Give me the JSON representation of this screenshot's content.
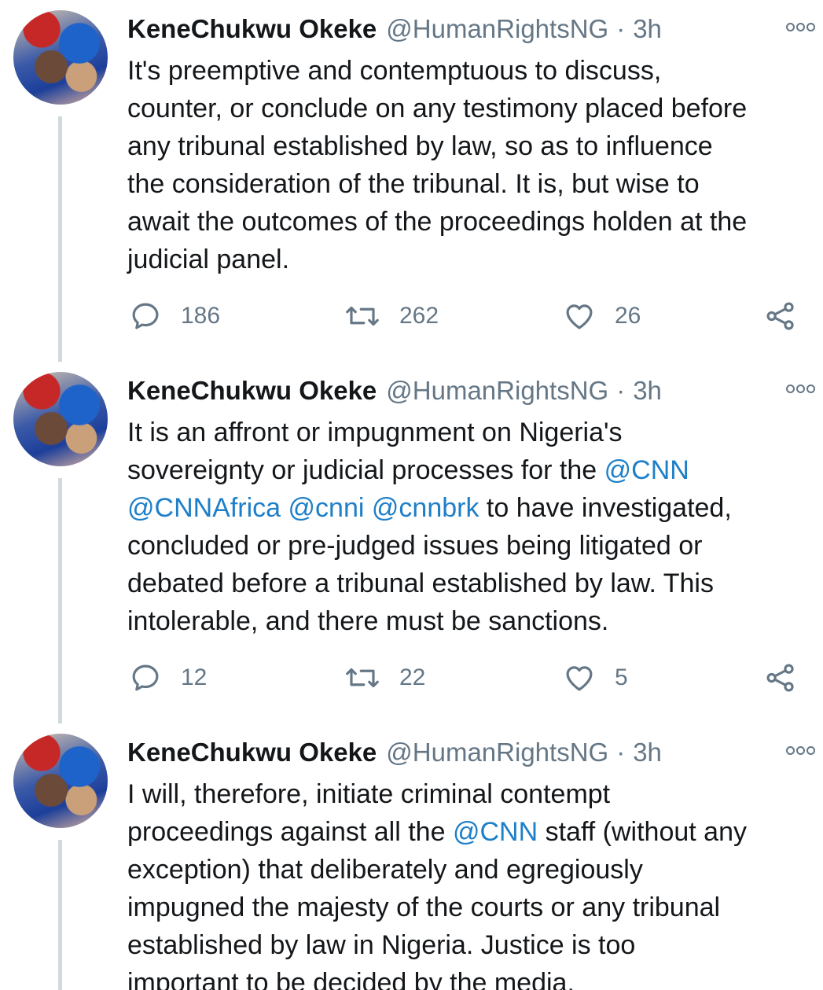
{
  "tweets": [
    {
      "author_name": "KeneChukwu Okeke",
      "handle": "@HumanRightsNG",
      "separator": "·",
      "time": "3h",
      "lines": [
        [
          {
            "t": "It's preemptive and contemptuous to discuss,"
          }
        ],
        [
          {
            "t": "counter, or conclude on any testimony placed before"
          }
        ],
        [
          {
            "t": "any tribunal established by law, so as to influence"
          }
        ],
        [
          {
            "t": "the consideration of the tribunal. It is, but wise to"
          }
        ],
        [
          {
            "t": "await the outcomes of the proceedings holden at the"
          }
        ],
        [
          {
            "t": "judicial panel."
          }
        ]
      ],
      "replies": "186",
      "retweets": "262",
      "likes": "26"
    },
    {
      "author_name": "KeneChukwu Okeke",
      "handle": "@HumanRightsNG",
      "separator": "·",
      "time": "3h",
      "lines": [
        [
          {
            "t": "It is an affront or impugnment on Nigeria's"
          }
        ],
        [
          {
            "t": "sovereignty or judicial processes for the "
          },
          {
            "m": "@CNN"
          }
        ],
        [
          {
            "m": "@CNNAfrica"
          },
          {
            "t": " "
          },
          {
            "m": "@cnni"
          },
          {
            "t": " "
          },
          {
            "m": "@cnnbrk"
          },
          {
            "t": " to have investigated,"
          }
        ],
        [
          {
            "t": "concluded or pre-judged issues being litigated or"
          }
        ],
        [
          {
            "t": "debated before a tribunal established by law. This"
          }
        ],
        [
          {
            "t": "intolerable, and there must be sanctions."
          }
        ]
      ],
      "replies": "12",
      "retweets": "22",
      "likes": "5"
    },
    {
      "author_name": "KeneChukwu Okeke",
      "handle": "@HumanRightsNG",
      "separator": "·",
      "time": "3h",
      "lines": [
        [
          {
            "t": "I will, therefore, initiate criminal contempt"
          }
        ],
        [
          {
            "t": "proceedings against all the "
          },
          {
            "m": "@CNN"
          },
          {
            "t": " staff (without any"
          }
        ],
        [
          {
            "t": "exception) that deliberately and egregiously"
          }
        ],
        [
          {
            "t": "impugned the majesty of the courts or any tribunal"
          }
        ],
        [
          {
            "t": "established by law in Nigeria. Justice is too"
          }
        ],
        [
          {
            "t": "important to be decided by the media."
          }
        ]
      ]
    }
  ],
  "colors": {
    "text": "#14171a",
    "secondary": "#657786",
    "mention": "#1d7fc8",
    "thread_line": "#cfd9de"
  },
  "icons": {
    "reply": "reply-icon",
    "retweet": "retweet-icon",
    "like": "heart-icon",
    "share": "share-icon",
    "more": "more-options-icon"
  }
}
